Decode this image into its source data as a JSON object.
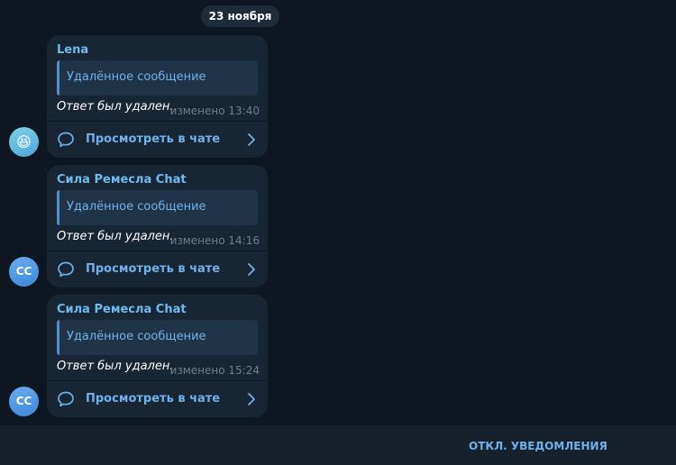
{
  "date_separator": "23 ноября",
  "messages": [
    {
      "sender": "Lena",
      "quote": "Удалённое сообщение",
      "text": "Ответ был удален.",
      "meta": "изменено 13:40",
      "view_label": "Просмотреть в чате",
      "avatar": {
        "type": "emoji",
        "content": "😆"
      }
    },
    {
      "sender": "Сила Ремесла Chat",
      "quote": "Удалённое сообщение",
      "text": "Ответ был удален.",
      "meta": "изменено 14:16",
      "view_label": "Просмотреть в чате",
      "avatar": {
        "type": "initials",
        "content": "СС"
      }
    },
    {
      "sender": "Сила Ремесла Chat",
      "quote": "Удалённое сообщение",
      "text": "Ответ был удален.",
      "meta": "изменено 15:24",
      "view_label": "Просмотреть в чате",
      "avatar": {
        "type": "initials",
        "content": "СС"
      }
    }
  ],
  "bottom_bar": {
    "mute_label": "ОТКЛ. УВЕДОМЛЕНИЯ"
  },
  "colors": {
    "background": "#0e1621",
    "bubble": "#182533",
    "accent": "#6fb1ec",
    "sender_name": "#71baf0",
    "meta_text": "#6d7f8f"
  },
  "icons": {
    "view": "comment-bubble-icon",
    "arrow": "chevron-right-icon"
  }
}
